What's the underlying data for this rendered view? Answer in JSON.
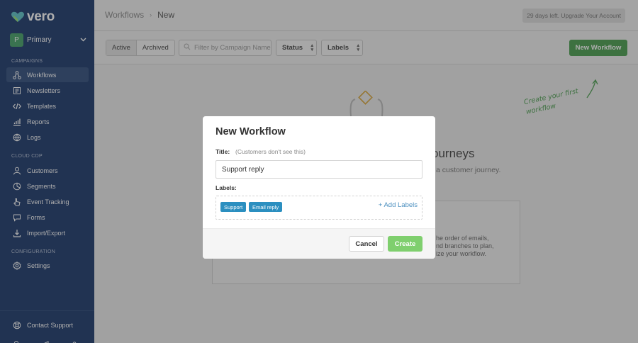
{
  "brand": {
    "name": "vero",
    "accent": "#4b9e4f",
    "sidebar_bg": "#1e3a6c"
  },
  "account": {
    "initial": "P",
    "name": "Primary"
  },
  "sidebar": {
    "sections": [
      {
        "heading": "CAMPAIGNS",
        "items": [
          {
            "label": "Workflows",
            "icon": "workflow-icon",
            "active": true
          },
          {
            "label": "Newsletters",
            "icon": "newsletter-icon"
          },
          {
            "label": "Templates",
            "icon": "code-icon"
          },
          {
            "label": "Reports",
            "icon": "chart-icon"
          },
          {
            "label": "Logs",
            "icon": "globe-icon"
          }
        ]
      },
      {
        "heading": "CLOUD CDP",
        "items": [
          {
            "label": "Customers",
            "icon": "user-icon"
          },
          {
            "label": "Segments",
            "icon": "segment-icon"
          },
          {
            "label": "Event Tracking",
            "icon": "pointer-icon"
          },
          {
            "label": "Forms",
            "icon": "chat-icon"
          },
          {
            "label": "Import/Export",
            "icon": "import-export-icon"
          }
        ]
      },
      {
        "heading": "CONFIGURATION",
        "items": [
          {
            "label": "Settings",
            "icon": "gear-icon"
          }
        ]
      }
    ],
    "footer": {
      "label": "Contact Support",
      "icon": "support-icon"
    }
  },
  "header": {
    "breadcrumb": [
      "Workflows",
      "New"
    ],
    "trial_text": "29 days left. Upgrade Your Account"
  },
  "toolbar": {
    "segments": [
      "Active",
      "Archived"
    ],
    "filter_placeholder": "Filter by Campaign Name",
    "status_label": "Status",
    "labels_label": "Labels",
    "new_button": "New Workflow"
  },
  "background": {
    "hint_line1": "Create your first",
    "hint_line2": "workflow",
    "heading_fragment": "ourneys",
    "sub_fragment": "a customer journey.",
    "card_line1": "he order of emails,",
    "card_line2": "nd branches to plan,",
    "card_line3": "ize your workflow."
  },
  "modal": {
    "title": "New Workflow",
    "title_label": "Title:",
    "title_hint": "(Customers don't see this)",
    "title_value": "Support reply",
    "labels_label": "Labels:",
    "tags": [
      "Support",
      "Email reply"
    ],
    "add_labels": "+ Add Labels",
    "cancel": "Cancel",
    "create": "Create"
  }
}
